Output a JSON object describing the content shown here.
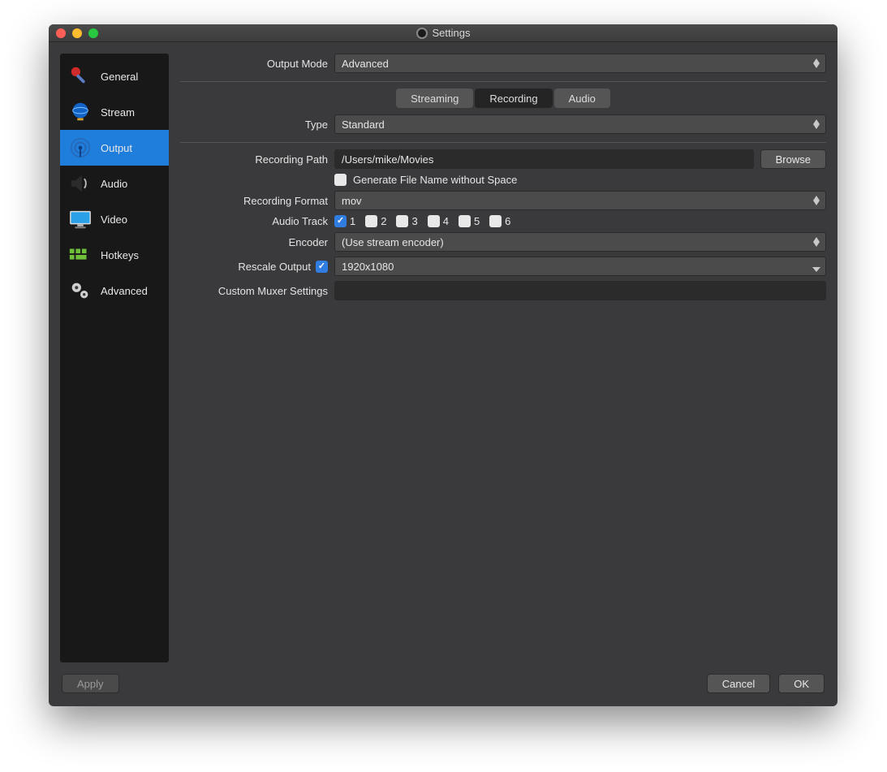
{
  "window": {
    "title": "Settings"
  },
  "sidebar": {
    "items": [
      {
        "label": "General"
      },
      {
        "label": "Stream"
      },
      {
        "label": "Output"
      },
      {
        "label": "Audio"
      },
      {
        "label": "Video"
      },
      {
        "label": "Hotkeys"
      },
      {
        "label": "Advanced"
      }
    ]
  },
  "output_mode": {
    "label": "Output Mode",
    "value": "Advanced"
  },
  "tabs": {
    "streaming": "Streaming",
    "recording": "Recording",
    "audio": "Audio"
  },
  "type": {
    "label": "Type",
    "value": "Standard"
  },
  "recording_path": {
    "label": "Recording Path",
    "value": "/Users/mike/Movies",
    "browse": "Browse"
  },
  "gen_no_space": {
    "label": "Generate File Name without Space",
    "checked": false
  },
  "recording_format": {
    "label": "Recording Format",
    "value": "mov"
  },
  "audio_track": {
    "label": "Audio Track",
    "tracks": [
      {
        "n": "1",
        "on": true
      },
      {
        "n": "2",
        "on": false
      },
      {
        "n": "3",
        "on": false
      },
      {
        "n": "4",
        "on": false
      },
      {
        "n": "5",
        "on": false
      },
      {
        "n": "6",
        "on": false
      }
    ]
  },
  "encoder": {
    "label": "Encoder",
    "value": "(Use stream encoder)"
  },
  "rescale": {
    "label": "Rescale Output",
    "checked": true,
    "value": "1920x1080"
  },
  "muxer": {
    "label": "Custom Muxer Settings",
    "value": ""
  },
  "buttons": {
    "apply": "Apply",
    "cancel": "Cancel",
    "ok": "OK"
  }
}
